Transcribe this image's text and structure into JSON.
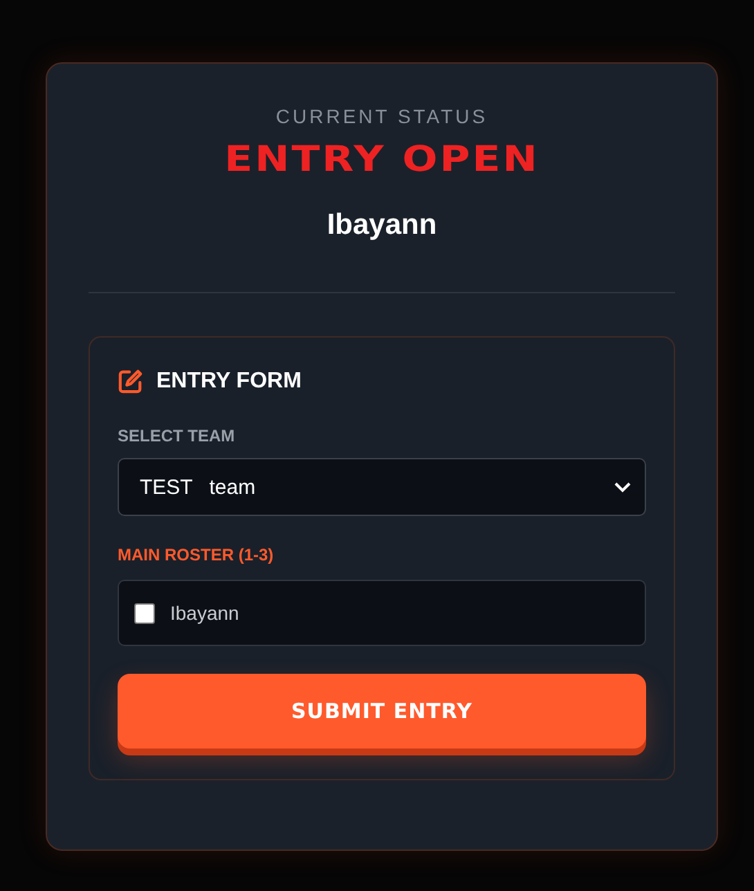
{
  "status": {
    "label": "CURRENT STATUS",
    "value": "ENTRY OPEN",
    "user": "Ibayann"
  },
  "form": {
    "title": "ENTRY FORM",
    "team_label": "SELECT TEAM",
    "team_value": "TEST team",
    "roster_label": "MAIN ROSTER (1-3)",
    "roster": [
      {
        "name": "Ibayann",
        "checked": false
      }
    ],
    "submit": "SUBMIT ENTRY"
  }
}
